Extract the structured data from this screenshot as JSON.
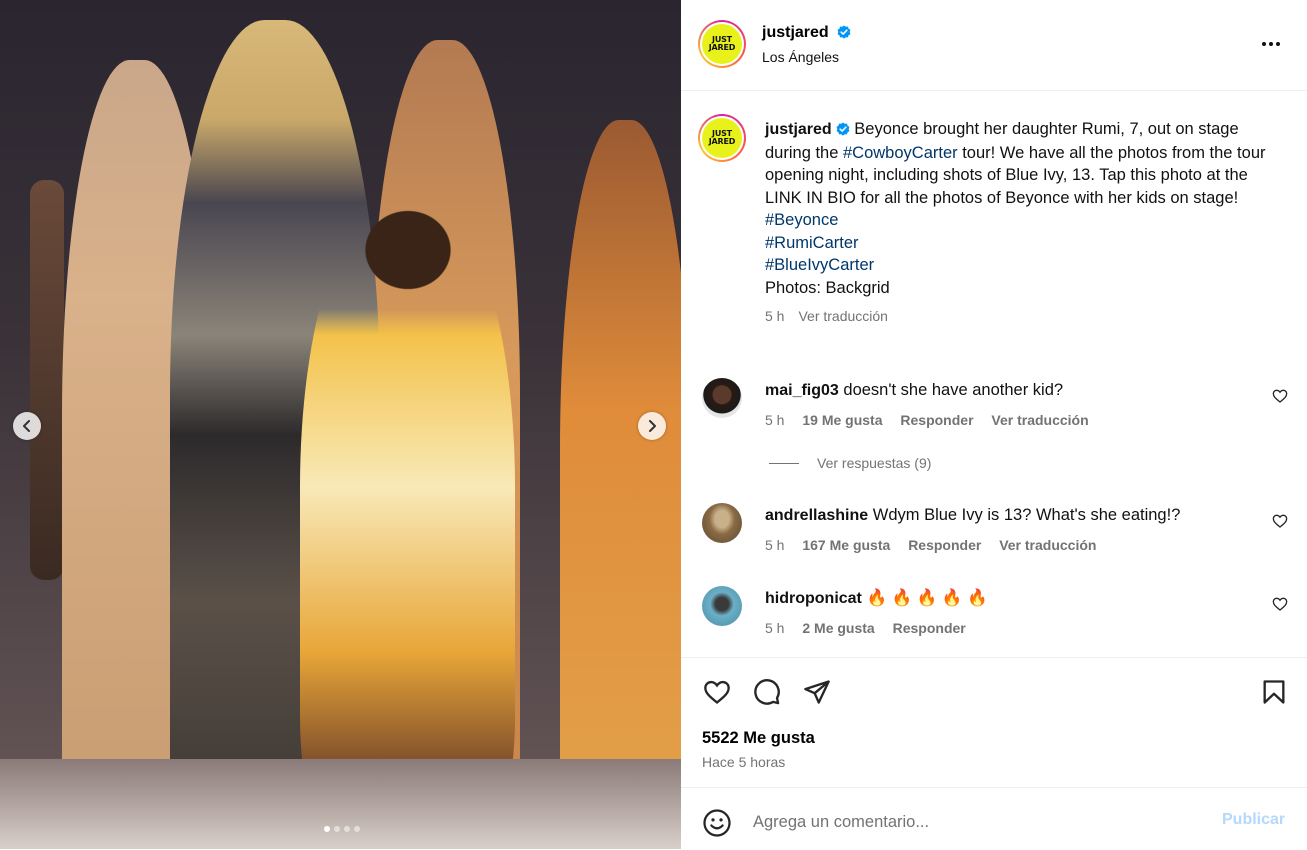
{
  "post": {
    "username": "justjared",
    "location": "Los Ángeles",
    "avatar_text_top": "JUST",
    "avatar_text_bottom": "JARED",
    "caption": {
      "text_before": "Beyonce brought her daughter Rumi, 7, out on stage during the ",
      "tag_inline": "#CowboyCarter",
      "text_after": " tour! We have all the photos from the tour opening night, including shots of Blue Ivy, 13. Tap this photo at the LINK IN BIO for all the photos of Beyonce with her kids on stage!",
      "hashtags": [
        "#Beyonce",
        "#RumiCarter",
        "#BlueIvyCarter"
      ],
      "credit": "Photos: Backgrid",
      "time": "5 h",
      "translate": "Ver traducción"
    }
  },
  "comments": [
    {
      "user": "mai_fig03",
      "text": "doesn't she have another kid?",
      "time": "5 h",
      "likes": "19 Me gusta",
      "reply": "Responder",
      "translate": "Ver traducción"
    },
    {
      "user": "andrellashine",
      "text": "Wdym Blue Ivy is 13? What's she eating!?",
      "time": "5 h",
      "likes": "167 Me gusta",
      "reply": "Responder",
      "translate": "Ver traducción"
    },
    {
      "user": "hidroponicat",
      "text": "🔥 🔥 🔥 🔥 🔥",
      "time": "5 h",
      "likes": "2 Me gusta",
      "reply": "Responder"
    }
  ],
  "view_replies": "Ver respuestas (9)",
  "likes_total": "5522 Me gusta",
  "posted_ago": "Hace 5 horas",
  "composer": {
    "placeholder": "Agrega un comentario...",
    "publish": "Publicar"
  },
  "carousel": {
    "slide_count": 4,
    "active_slide": 1
  },
  "colors": {
    "link": "#00376b",
    "muted": "#737373",
    "publish_disabled": "#b5d8fb",
    "verified": "#0095f6",
    "logo_yellow": "#e8f21a"
  },
  "icons": [
    "verified-icon",
    "more-options-icon",
    "heart-icon",
    "comment-icon",
    "share-icon",
    "bookmark-icon",
    "emoji-icon",
    "chevron-left-icon",
    "chevron-right-icon"
  ]
}
